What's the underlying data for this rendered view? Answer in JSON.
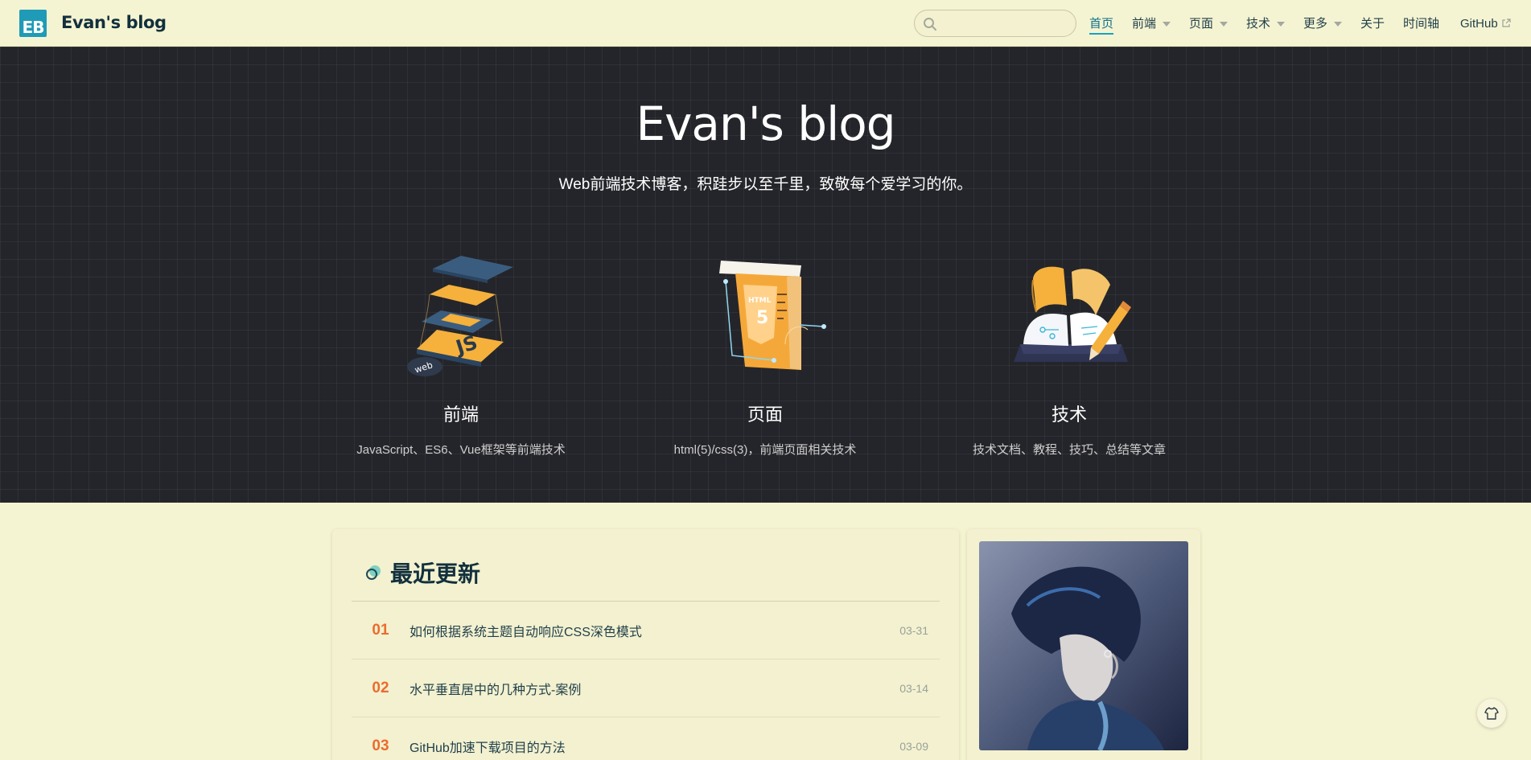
{
  "header": {
    "logo_text": "EB",
    "site_name": "Evan's blog",
    "search": {
      "placeholder": "",
      "value": ""
    },
    "nav": {
      "home": "首页",
      "frontend": "前端",
      "pages": "页面",
      "tech": "技术",
      "more": "更多",
      "about": "关于",
      "timeline": "时间轴",
      "github": "GitHub"
    }
  },
  "hero": {
    "title": "Evan's blog",
    "subtitle": "Web前端技术博客，积跬步以至千里，致敬每个爱学习的你。",
    "features": [
      {
        "title": "前端",
        "desc": "JavaScript、ES6、Vue框架等前端技术",
        "icon": "js-layers-icon"
      },
      {
        "title": "页面",
        "desc": "html(5)/css(3)，前端页面相关技术",
        "icon": "html5-page-icon"
      },
      {
        "title": "技术",
        "desc": "技术文档、教程、技巧、总结等文章",
        "icon": "book-pencil-icon"
      }
    ]
  },
  "recent": {
    "title": "最近更新",
    "posts": [
      {
        "num": "01",
        "title": "如何根据系统主题自动响应CSS深色模式",
        "date": "03-31"
      },
      {
        "num": "02",
        "title": "水平垂直居中的几种方式-案例",
        "date": "03-14"
      },
      {
        "num": "03",
        "title": "GitHub加速下载项目的方法",
        "date": "03-09"
      }
    ]
  },
  "colors": {
    "header_bg": "#f5f4d2",
    "hero_bg": "#24252a",
    "accent": "#16a3c0",
    "post_number": "#eb6c2e",
    "text": "#1f3e4a"
  }
}
